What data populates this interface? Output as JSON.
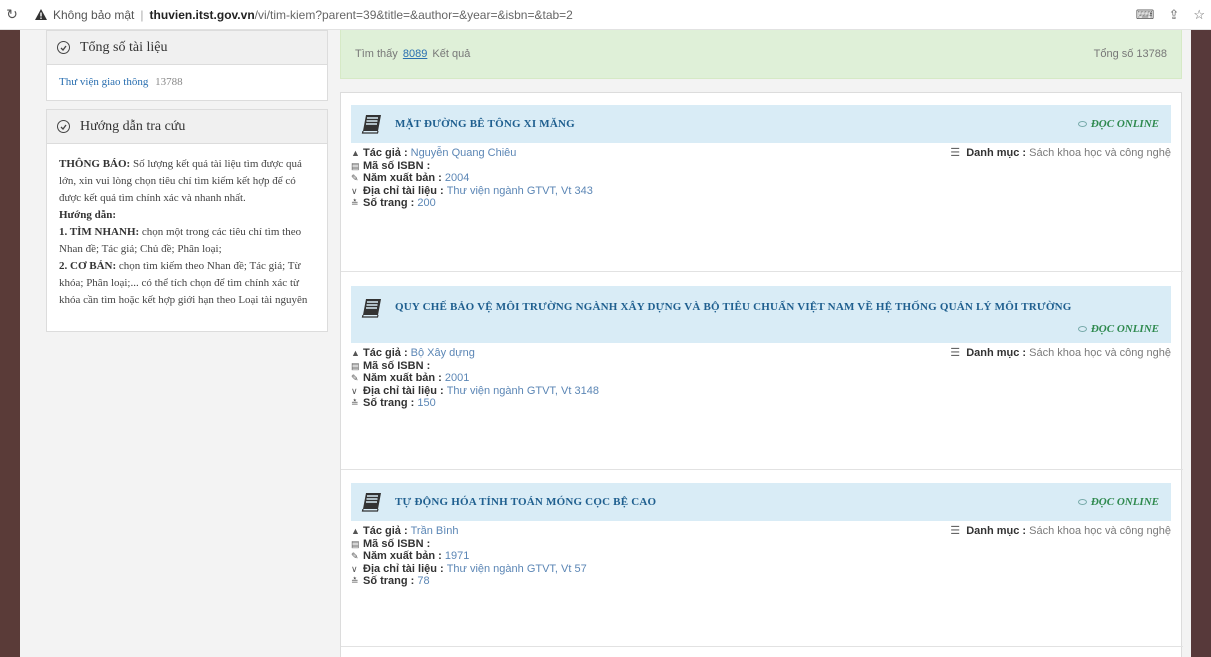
{
  "browser": {
    "not_secure": "Không bảo mật",
    "separator": "|",
    "url_host": "thuvien.itst.gov.vn",
    "url_path": "/vi/tim-kiem?parent=39&title=&author=&year=&isbn=&tab=2"
  },
  "sidebar": {
    "total_docs": {
      "title": "Tổng số tài liệu",
      "library_name": "Thư viện giao thông",
      "library_count": "13788"
    },
    "guide": {
      "title": "Hướng dẫn tra cứu",
      "notice_label": "THÔNG BÁO:",
      "notice_text": "Số lượng kết quả tài liệu tìm được quá lớn, xin vui lòng chọn tiêu chí tìm kiếm kết hợp để có được kết quả tìm chính xác và nhanh nhất.",
      "guide_label": "Hướng dẫn:",
      "quick_label": "1. TÌM NHANH:",
      "quick_text": "chọn một trong các tiêu chí tìm theo Nhan đề; Tác giả; Chủ đề; Phân loại;",
      "basic_label": "2. CƠ BẢN:",
      "basic_text": "chọn tìm kiếm theo Nhan đề; Tác giả; Từ khóa; Phân loại;... có thể tích chọn để tìm chính xác từ khóa cần tìm hoặc kết hợp giới hạn theo Loại tài nguyên"
    }
  },
  "results": {
    "found_prefix": "Tìm thấy",
    "found_count": "8089",
    "found_suffix": "Kết quả",
    "total_label": "Tổng số 13788",
    "read_online": "ĐỌC ONLINE",
    "labels": {
      "author": "Tác giả :",
      "isbn": "Mã số ISBN :",
      "year": "Năm xuất bản :",
      "location": "Địa chỉ tài liệu :",
      "pages": "Số trang :",
      "category": "Danh mục :"
    },
    "items": [
      {
        "title": "MẶT ĐƯỜNG BÊ TÔNG XI MĂNG",
        "author": "Nguyễn Quang Chiêu",
        "isbn": "",
        "year": "2004",
        "location": "Thư viện ngành GTVT, Vt 343",
        "pages": "200",
        "category": "Sách khoa học và công nghệ"
      },
      {
        "title": "QUY CHẾ BẢO VỆ MÔI TRƯỜNG NGÀNH XÂY DỰNG VÀ BỘ TIÊU CHUẨN VIỆT NAM VỀ HỆ THỐNG QUẢN LÝ MÔI TRƯỜNG",
        "author": "Bộ Xây dựng",
        "isbn": "",
        "year": "2001",
        "location": "Thư viện ngành GTVT, Vt 3148",
        "pages": "150",
        "category": "Sách khoa học và công nghệ"
      },
      {
        "title": "TỰ ĐỘNG HÓA TÍNH TOÁN MÓNG CỌC BỆ CAO",
        "author": "Trần Bình",
        "isbn": "",
        "year": "1971",
        "location": "Thư viện ngành GTVT, Vt 57",
        "pages": "78",
        "category": "Sách khoa học và công nghệ"
      }
    ]
  }
}
